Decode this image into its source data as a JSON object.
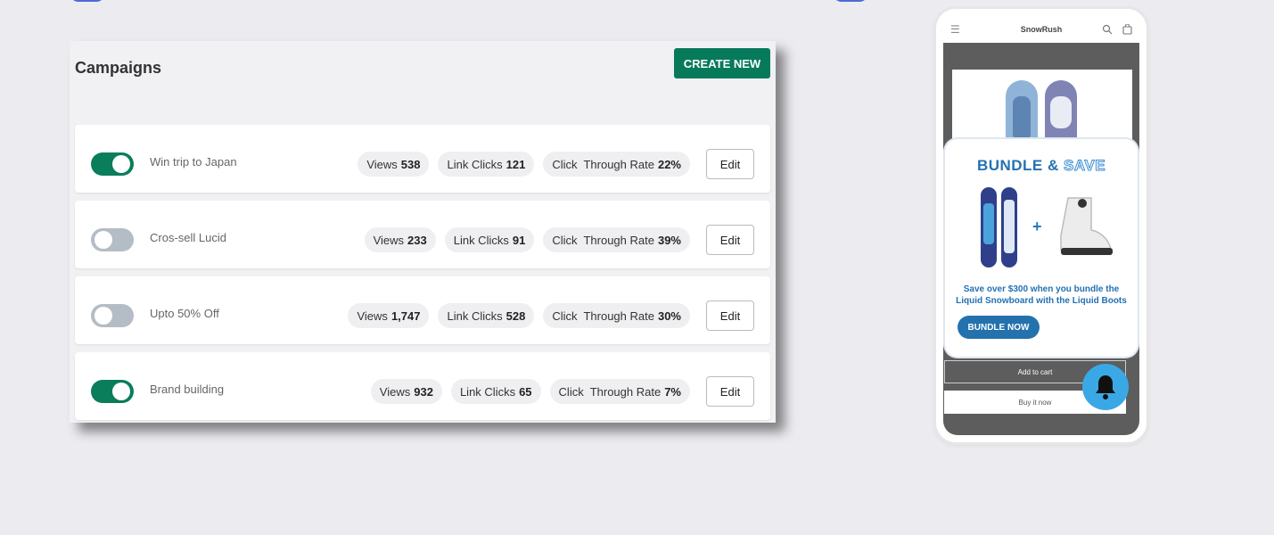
{
  "campaigns": {
    "title": "Campaigns",
    "create_label": "CREATE NEW",
    "rows": [
      {
        "name": "Win trip to Japan",
        "views": "538",
        "clicks": "121",
        "ctr": "22%",
        "enabled": true
      },
      {
        "name": "Cros-sell Lucid",
        "views": "233",
        "clicks": "91",
        "ctr": "39%",
        "enabled": false
      },
      {
        "name": "Upto 50% Off",
        "views": "1,747",
        "clicks": "528",
        "ctr": "30%",
        "enabled": false
      },
      {
        "name": "Brand building",
        "views": "932",
        "clicks": "65",
        "ctr": "7%",
        "enabled": true
      }
    ],
    "labels": {
      "views": "Views",
      "clicks": "Link Clicks",
      "ctr": "Click  Through Rate",
      "edit": "Edit"
    }
  },
  "phone": {
    "brand": "SnowRush",
    "popup": {
      "title_a": "BUNDLE &",
      "title_b": "SAVE",
      "plus": "+",
      "text": "Save over $300 when you bundle the Liquid Snowboard with the Liquid Boots",
      "cta": "BUNDLE NOW"
    },
    "add_to_cart": "Add to cart",
    "buy_now": "Buy it now"
  },
  "colors": {
    "primary_green": "#087a5c",
    "toggle_off": "#b4bcc5",
    "popup_blue": "#2471b3",
    "bell_blue": "#3ba8e6"
  }
}
